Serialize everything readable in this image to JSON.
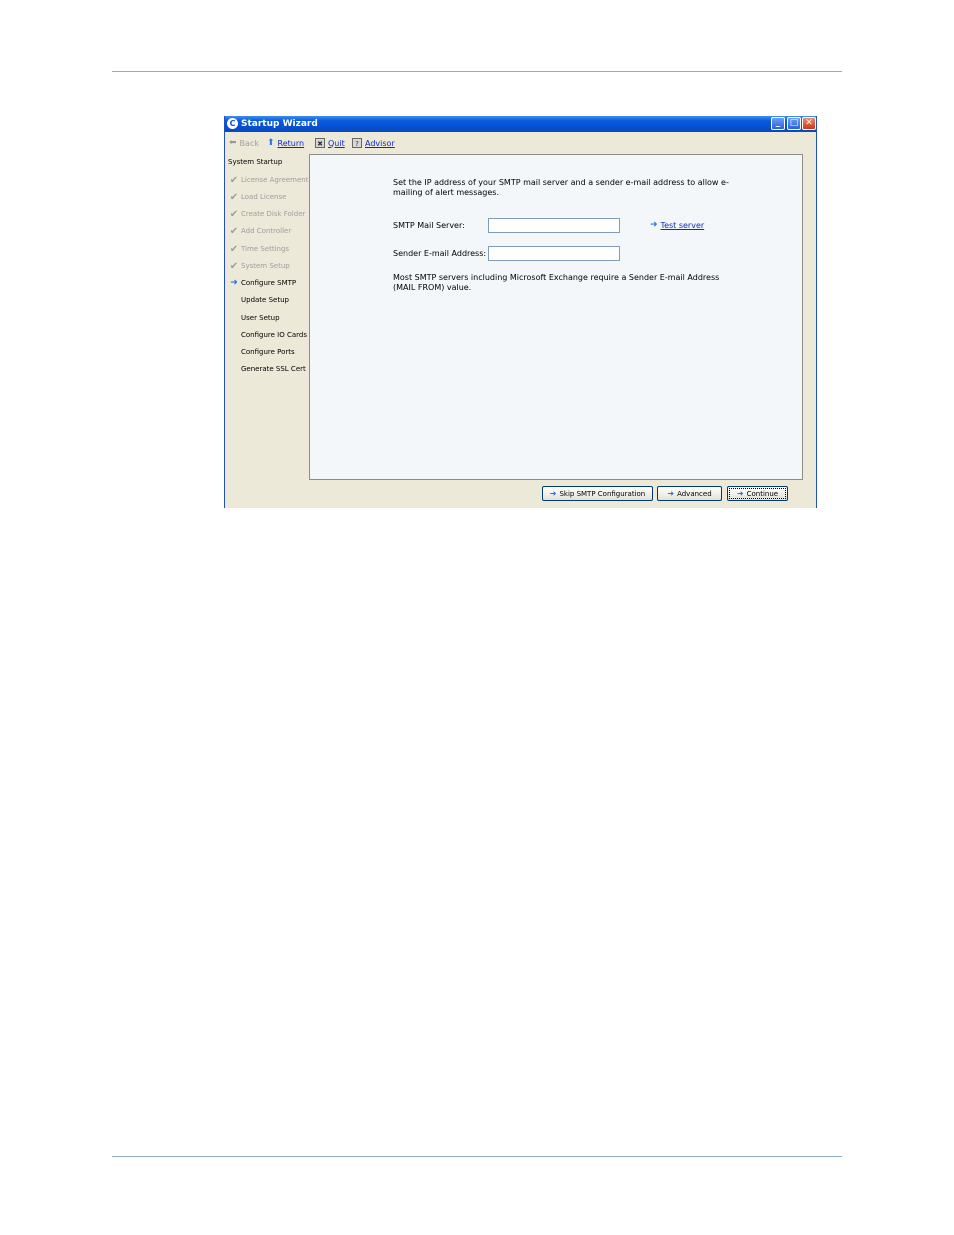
{
  "window": {
    "title": "Startup Wizard",
    "app_icon_glyph": "C",
    "controls": {
      "minimize": "_",
      "maximize": "□",
      "close": "✕"
    }
  },
  "toolbar": {
    "back": "Back",
    "return": "Return",
    "quit": "Quit",
    "advisor": "Advisor"
  },
  "sidebar": {
    "header": "System Startup",
    "steps": [
      {
        "label": "License Agreement",
        "state": "done"
      },
      {
        "label": "Load License",
        "state": "done"
      },
      {
        "label": "Create Disk Folder",
        "state": "done"
      },
      {
        "label": "Add Controller",
        "state": "done"
      },
      {
        "label": "Time Settings",
        "state": "done"
      },
      {
        "label": "System Setup",
        "state": "done"
      },
      {
        "label": "Configure SMTP",
        "state": "current"
      },
      {
        "label": "Update Setup",
        "state": "pending"
      },
      {
        "label": "User Setup",
        "state": "pending"
      },
      {
        "label": "Configure IO Cards",
        "state": "pending"
      },
      {
        "label": "Configure Ports",
        "state": "pending"
      },
      {
        "label": "Generate SSL Cert",
        "state": "pending"
      }
    ]
  },
  "content": {
    "description": "Set the IP address of your SMTP mail server and a sender e-mail address to allow e-mailing of alert messages.",
    "smtp_label": "SMTP Mail Server:",
    "smtp_value": "",
    "sender_label": "Sender E-mail Address:",
    "sender_value": "",
    "test_server": "Test server",
    "note": "Most SMTP servers including Microsoft Exchange require a Sender E-mail Address (MAIL FROM) value."
  },
  "footer": {
    "skip": "Skip SMTP Configuration",
    "advanced": "Advanced",
    "continue": "Continue"
  },
  "colors": {
    "titlebar": "#0a5bd9",
    "link": "#0c2bc9",
    "done_step": "#9d9d9d",
    "arrow": "#2d6fe0"
  }
}
